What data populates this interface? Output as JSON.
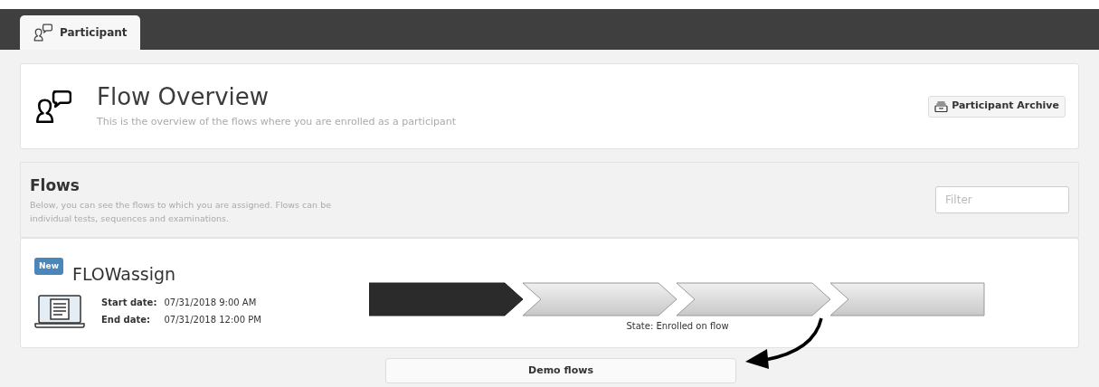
{
  "tabs": [
    {
      "label": "Participant",
      "selected": true
    }
  ],
  "overview": {
    "title": "Flow Overview",
    "subtitle": "This is the overview of the flows where you are enrolled as a participant",
    "archive_button": "Participant Archive"
  },
  "flows_panel": {
    "title": "Flows",
    "description": "Below, you can see the flows to which you are assigned. Flows can be individual tests, sequences and examinations.",
    "filter": {
      "placeholder": "Filter"
    }
  },
  "flows": [
    {
      "badge": "New",
      "name": "FLOWassign",
      "start_label": "Start date:",
      "start_value": "07/31/2018 9:00 AM",
      "end_label": "End date:",
      "end_value": "07/31/2018 12:00 PM",
      "state": "State: Enrolled on flow",
      "steps": [
        {
          "done": true
        },
        {
          "done": false
        },
        {
          "done": false
        },
        {
          "done": false
        }
      ]
    }
  ],
  "demo_button": "Demo flows"
}
